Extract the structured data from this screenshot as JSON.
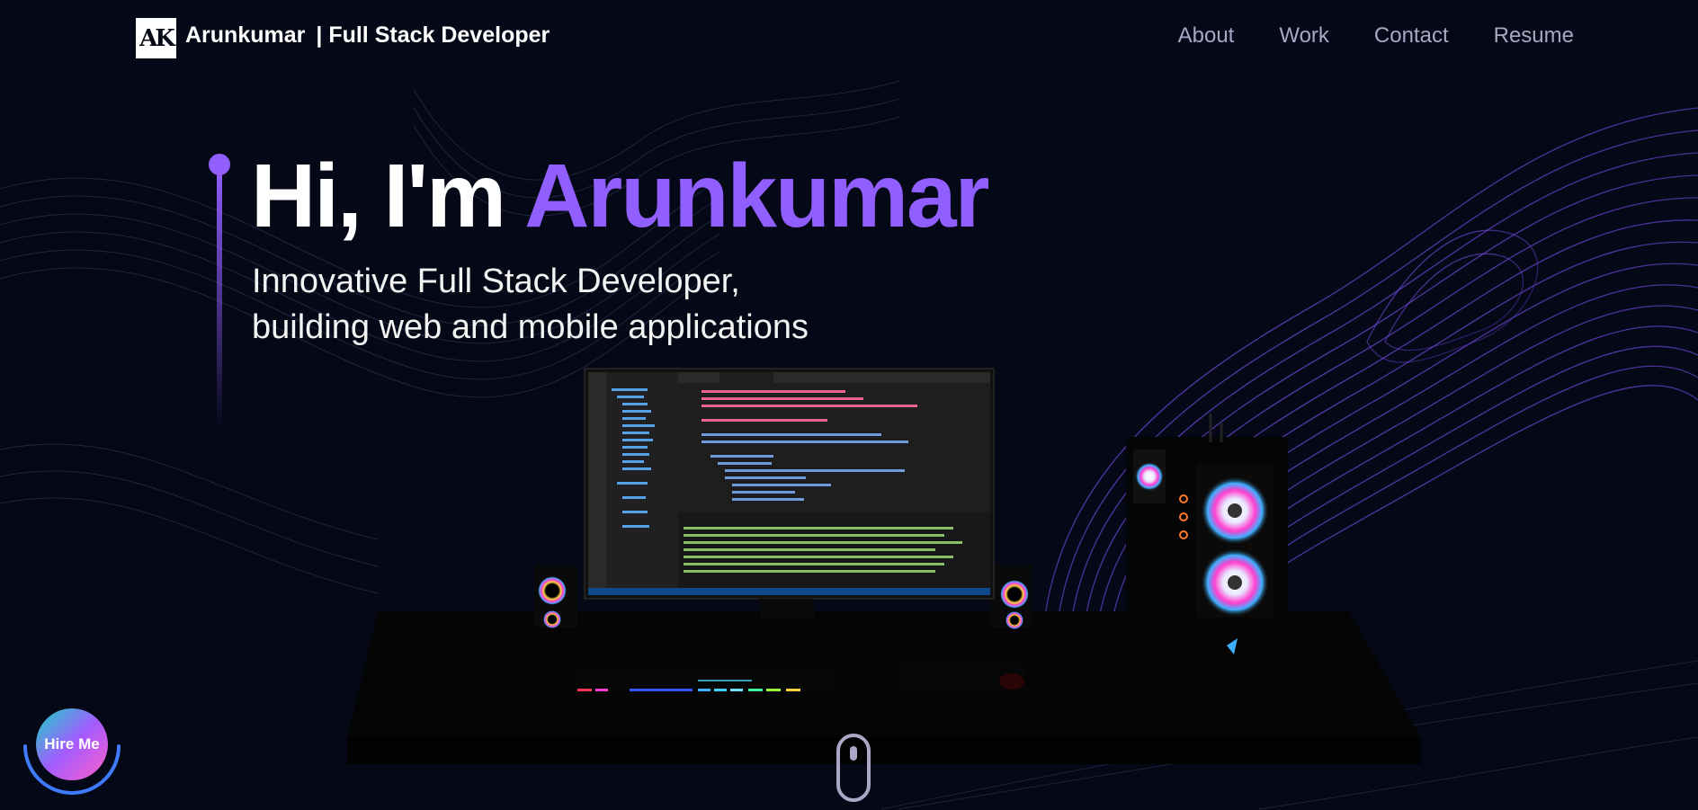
{
  "nav": {
    "logo_text": "AK",
    "brand_name": "Arunkumar",
    "brand_tagline": "| Full Stack Developer",
    "links": [
      "About",
      "Work",
      "Contact",
      "Resume"
    ]
  },
  "hero": {
    "greeting": "Hi, I'm",
    "name": "Arunkumar",
    "subtitle_line1": "Innovative Full Stack Developer,",
    "subtitle_line2": "building web and mobile applications"
  },
  "hire_button": {
    "label": "Hire Me"
  },
  "colors": {
    "background": "#050816",
    "accent": "#915eff",
    "nav_text": "#aaa6c3"
  },
  "icons": [
    "scroll-mouse-icon",
    "brand-logo-icon"
  ]
}
